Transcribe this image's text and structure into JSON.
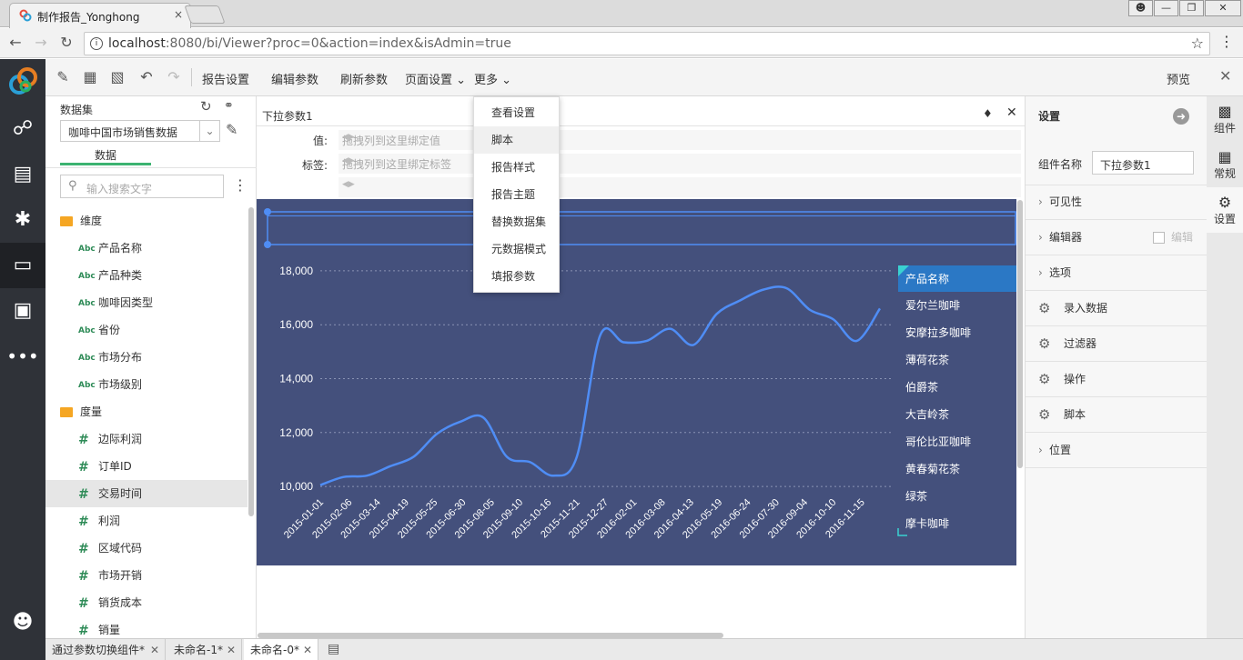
{
  "browser": {
    "tab_title": "制作报告_Yonghong",
    "tab_close": "×",
    "url_host": "localhost",
    "url_rest": ":8080/bi/Viewer?proc=0&action=index&isAdmin=true"
  },
  "toolbar": {
    "report_settings": "报告设置",
    "edit_params": "编辑参数",
    "refresh_params": "刷新参数",
    "page_settings": "页面设置",
    "more": "更多",
    "preview": "预览"
  },
  "dropdown": {
    "items": [
      "查看设置",
      "脚本",
      "报告样式",
      "报告主题",
      "替换数据集",
      "元数据模式",
      "填报参数"
    ]
  },
  "datapanel": {
    "header": "数据集",
    "dataset": "咖啡中国市场销售数据",
    "tab": "数据",
    "search_placeholder": "输入搜索文字",
    "dimension_folder": "维度",
    "dimensions": [
      "产品名称",
      "产品种类",
      "咖啡因类型",
      "省份",
      "市场分布",
      "市场级别"
    ],
    "measure_folder": "度量",
    "measures": [
      "边际利润",
      "订单ID",
      "交易时间",
      "利润",
      "区域代码",
      "市场开销",
      "销货成本",
      "销量"
    ],
    "abc_badge": "Abc",
    "hash_badge": "#"
  },
  "component": {
    "title": "下拉参数1",
    "value_label": "值:",
    "value_placeholder": "拖拽列到这里绑定值",
    "tag_label": "标签:",
    "tag_placeholder": "拖拽列到这里绑定标签"
  },
  "chart_data": {
    "type": "line",
    "x": [
      "2015-01-01",
      "2015-02-06",
      "2015-03-14",
      "2015-04-19",
      "2015-05-25",
      "2015-06-30",
      "2015-08-05",
      "2015-09-10",
      "2015-10-16",
      "2015-11-21",
      "2015-12-27",
      "2016-02-01",
      "2016-03-08",
      "2016-04-13",
      "2016-05-19",
      "2016-06-24",
      "2016-07-30",
      "2016-09-04",
      "2016-10-10",
      "2016-11-15"
    ],
    "series": [
      {
        "values": [
          10050,
          10350,
          10400,
          10750,
          11100,
          11950,
          12400,
          12550,
          11100,
          10900,
          10400,
          11100,
          15600,
          15350,
          15400,
          15850,
          15250,
          16400,
          16900,
          17300,
          17350,
          16550,
          16200,
          15400,
          16600
        ]
      }
    ],
    "y_ticks": [
      "10,000",
      "12,000",
      "14,000",
      "16,000",
      "18,000"
    ],
    "ylim": [
      9800,
      18300
    ],
    "grid": true,
    "legend_title": "产品名称",
    "legend": [
      "爱尔兰咖啡",
      "安摩拉多咖啡",
      "薄荷花茶",
      "伯爵茶",
      "大吉岭茶",
      "哥伦比亚咖啡",
      "黄春菊花茶",
      "绿茶",
      "摩卡咖啡"
    ],
    "legend_position": "right",
    "colors": {
      "background": "#44507c",
      "line": "#4f8df5",
      "grid": "#8a93b4"
    }
  },
  "rightpanel": {
    "title": "设置",
    "name_label": "组件名称",
    "name_value": "下拉参数1",
    "visibility": "可见性",
    "editor": "编辑器",
    "editor_check": "编辑",
    "options": "选项",
    "input_data": "录入数据",
    "filter": "过滤器",
    "operation": "操作",
    "script": "脚本",
    "position": "位置"
  },
  "righttabs": {
    "component": "组件",
    "normal": "常规",
    "settings": "设置"
  },
  "bottomtabs": [
    {
      "label": "通过参数切换组件*"
    },
    {
      "label": "未命名-1*"
    },
    {
      "label": "未命名-0*"
    }
  ]
}
